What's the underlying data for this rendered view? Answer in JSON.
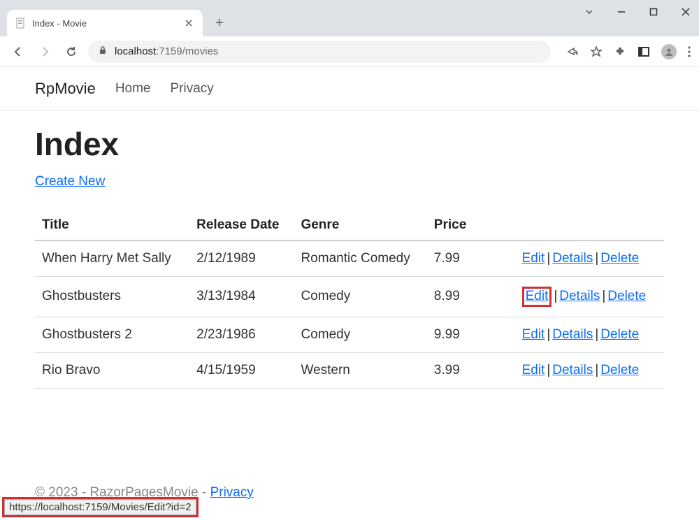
{
  "browser": {
    "tab_title": "Index - Movie",
    "url_host": "localhost",
    "url_port_path": ":7159/movies",
    "status_text": "https://localhost:7159/Movies/Edit?id=2"
  },
  "navbar": {
    "brand": "RpMovie",
    "links": [
      "Home",
      "Privacy"
    ]
  },
  "page": {
    "heading": "Index",
    "create_new": "Create New"
  },
  "table": {
    "headers": [
      "Title",
      "Release Date",
      "Genre",
      "Price"
    ],
    "rows": [
      {
        "title": "When Harry Met Sally",
        "date": "2/12/1989",
        "genre": "Romantic Comedy",
        "price": "7.99"
      },
      {
        "title": "Ghostbusters",
        "date": "3/13/1984",
        "genre": "Comedy",
        "price": "8.99"
      },
      {
        "title": "Ghostbusters 2",
        "date": "2/23/1986",
        "genre": "Comedy",
        "price": "9.99"
      },
      {
        "title": "Rio Bravo",
        "date": "4/15/1959",
        "genre": "Western",
        "price": "3.99"
      }
    ],
    "actions": {
      "edit": "Edit",
      "details": "Details",
      "delete": "Delete"
    }
  },
  "footer": {
    "text_prefix": "© 2023 - RazorPagesMovie - ",
    "privacy": "Privacy"
  }
}
